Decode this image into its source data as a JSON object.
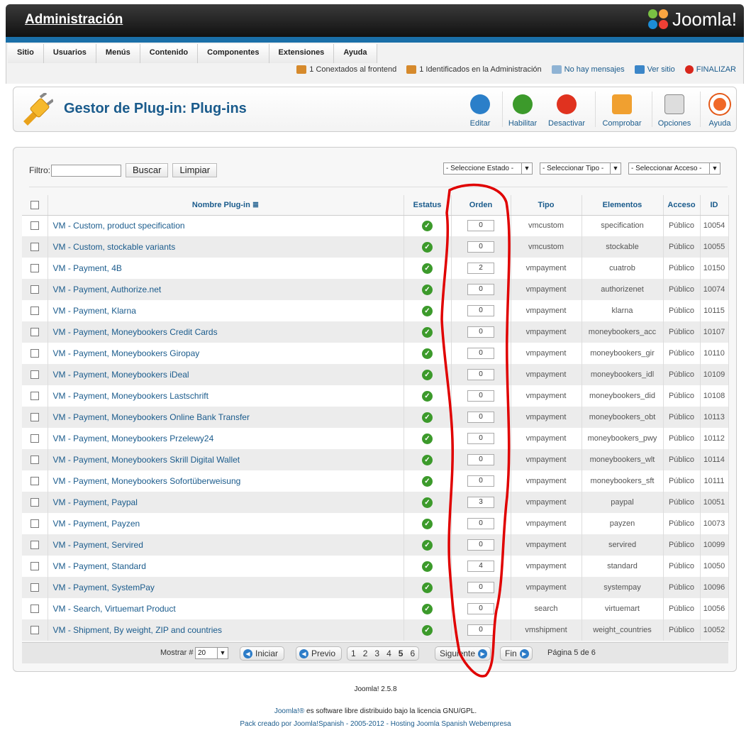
{
  "header": {
    "title": "Administración",
    "logo_text": "Joomla!"
  },
  "menu": [
    "Sitio",
    "Usuarios",
    "Menús",
    "Contenido",
    "Componentes",
    "Extensiones",
    "Ayuda"
  ],
  "status": {
    "frontend": "1 Conextados al frontend",
    "admin": "1 Identificados en la Administración",
    "messages": "No hay mensajes",
    "view_site": "Ver sitio",
    "logout": "FINALIZAR"
  },
  "toolbar": {
    "title": "Gestor de Plug-in: Plug-ins",
    "buttons": [
      "Editar",
      "Habilitar",
      "Desactivar",
      "Comprobar",
      "Opciones",
      "Ayuda"
    ]
  },
  "filter": {
    "label": "Filtro:",
    "search": "Buscar",
    "clear": "Limpiar",
    "state": "- Seleccione Estado -",
    "type": "- Seleccionar Tipo -",
    "access": "- Seleccionar Acceso -"
  },
  "columns": [
    "Nombre Plug-in",
    "Estatus",
    "Orden",
    "Tipo",
    "Elementos",
    "Acceso",
    "ID"
  ],
  "rows": [
    {
      "name": "VM - Custom, product specification",
      "order": "0",
      "type": "vmcustom",
      "element": "specification",
      "access": "Público",
      "id": "10054"
    },
    {
      "name": "VM - Custom, stockable variants",
      "order": "0",
      "type": "vmcustom",
      "element": "stockable",
      "access": "Público",
      "id": "10055"
    },
    {
      "name": "VM - Payment, 4B",
      "order": "2",
      "type": "vmpayment",
      "element": "cuatrob",
      "access": "Público",
      "id": "10150"
    },
    {
      "name": "VM - Payment, Authorize.net",
      "order": "0",
      "type": "vmpayment",
      "element": "authorizenet",
      "access": "Público",
      "id": "10074"
    },
    {
      "name": "VM - Payment, Klarna",
      "order": "0",
      "type": "vmpayment",
      "element": "klarna",
      "access": "Público",
      "id": "10115"
    },
    {
      "name": "VM - Payment, Moneybookers Credit Cards",
      "order": "0",
      "type": "vmpayment",
      "element": "moneybookers_acc",
      "access": "Público",
      "id": "10107"
    },
    {
      "name": "VM - Payment, Moneybookers Giropay",
      "order": "0",
      "type": "vmpayment",
      "element": "moneybookers_gir",
      "access": "Público",
      "id": "10110"
    },
    {
      "name": "VM - Payment, Moneybookers iDeal",
      "order": "0",
      "type": "vmpayment",
      "element": "moneybookers_idl",
      "access": "Público",
      "id": "10109"
    },
    {
      "name": "VM - Payment, Moneybookers Lastschrift",
      "order": "0",
      "type": "vmpayment",
      "element": "moneybookers_did",
      "access": "Público",
      "id": "10108"
    },
    {
      "name": "VM - Payment, Moneybookers Online Bank Transfer",
      "order": "0",
      "type": "vmpayment",
      "element": "moneybookers_obt",
      "access": "Público",
      "id": "10113"
    },
    {
      "name": "VM - Payment, Moneybookers Przelewy24",
      "order": "0",
      "type": "vmpayment",
      "element": "moneybookers_pwy",
      "access": "Público",
      "id": "10112"
    },
    {
      "name": "VM - Payment, Moneybookers Skrill Digital Wallet",
      "order": "0",
      "type": "vmpayment",
      "element": "moneybookers_wlt",
      "access": "Público",
      "id": "10114"
    },
    {
      "name": "VM - Payment, Moneybookers Sofortüberweisung",
      "order": "0",
      "type": "vmpayment",
      "element": "moneybookers_sft",
      "access": "Público",
      "id": "10111"
    },
    {
      "name": "VM - Payment, Paypal",
      "order": "3",
      "type": "vmpayment",
      "element": "paypal",
      "access": "Público",
      "id": "10051"
    },
    {
      "name": "VM - Payment, Payzen",
      "order": "0",
      "type": "vmpayment",
      "element": "payzen",
      "access": "Público",
      "id": "10073"
    },
    {
      "name": "VM - Payment, Servired",
      "order": "0",
      "type": "vmpayment",
      "element": "servired",
      "access": "Público",
      "id": "10099"
    },
    {
      "name": "VM - Payment, Standard",
      "order": "4",
      "type": "vmpayment",
      "element": "standard",
      "access": "Público",
      "id": "10050"
    },
    {
      "name": "VM - Payment, SystemPay",
      "order": "0",
      "type": "vmpayment",
      "element": "systempay",
      "access": "Público",
      "id": "10096"
    },
    {
      "name": "VM - Search, Virtuemart Product",
      "order": "0",
      "type": "search",
      "element": "virtuemart",
      "access": "Público",
      "id": "10056"
    },
    {
      "name": "VM - Shipment, By weight, ZIP and countries",
      "order": "0",
      "type": "vmshipment",
      "element": "weight_countries",
      "access": "Público",
      "id": "10052"
    }
  ],
  "pagination": {
    "show_label": "Mostrar #",
    "show_value": "20",
    "start": "Iniciar",
    "prev": "Previo",
    "pages": [
      "1",
      "2",
      "3",
      "4",
      "5",
      "6"
    ],
    "current": "5",
    "next": "Siguiente",
    "end": "Fin",
    "info": "Página 5 de 6"
  },
  "footer": {
    "version": "Joomla! 2.5.8",
    "license_link": "Joomla!®",
    "license_text": " es software libre distribuido bajo la licencia GNU/GPL.",
    "pack": "Pack creado por Joomla!Spanish - 2005-2012 - Hosting Joomla Spanish Webempresa"
  },
  "colors": {
    "brand_blue": "#1a6fa8",
    "link": "#1a5b8c",
    "status_ok": "#3c9a2b",
    "annotation": "#e00000"
  }
}
